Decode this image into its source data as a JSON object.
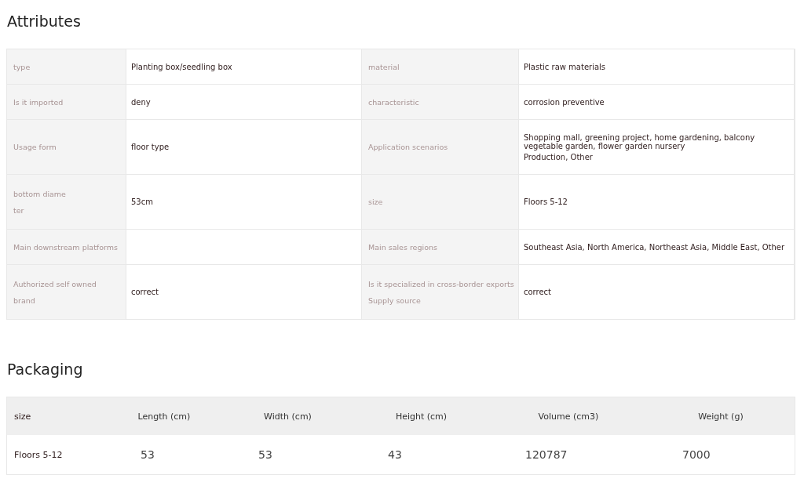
{
  "attributes": {
    "title": "Attributes",
    "rows": [
      {
        "cells": [
          {
            "label": [
              "type"
            ],
            "value": [
              "Planting box/seedling box"
            ]
          },
          {
            "label": [
              "material"
            ],
            "value": [
              "Plastic raw materials"
            ]
          }
        ]
      },
      {
        "cells": [
          {
            "label": [
              "Is it imported"
            ],
            "value": [
              "deny"
            ]
          },
          {
            "label": [
              "characteristic"
            ],
            "value": [
              "corrosion preventive"
            ]
          }
        ]
      },
      {
        "cells": [
          {
            "label": [
              "Usage form"
            ],
            "value": [
              "floor type"
            ]
          },
          {
            "label": [
              "Application scenarios"
            ],
            "value": [
              "Shopping mall, greening project, home gardening, balcony vegetable garden, flower garden nursery",
              "Production, Other"
            ]
          }
        ]
      },
      {
        "cells": [
          {
            "label": [
              "bottom diame",
              "ter"
            ],
            "value": [
              "53cm"
            ]
          },
          {
            "label": [
              "size"
            ],
            "value": [
              "Floors 5-12"
            ]
          }
        ]
      },
      {
        "cells": [
          {
            "label": [
              "Main downstream platforms"
            ]
          },
          {
            "label": [
              "Main sales regions"
            ],
            "value": [
              "Southeast Asia, North America, Northeast Asia, Middle East, Other"
            ]
          }
        ]
      },
      {
        "cells": [
          {
            "label": [
              "Authorized self owned",
              "brand"
            ],
            "value": [
              "correct"
            ]
          },
          {
            "label": [
              "Is it specialized in cross-border exports",
              "Supply source"
            ],
            "value": [
              "correct"
            ]
          }
        ]
      }
    ]
  },
  "packaging": {
    "title": "Packaging",
    "columns": [
      "size",
      "Length (cm)",
      "Width (cm)",
      "Height (cm)",
      "Volume (cm3)",
      "Weight (g)"
    ],
    "rows": [
      [
        "Floors 5-12",
        "53",
        "53",
        "43",
        "120787",
        "7000"
      ]
    ]
  }
}
